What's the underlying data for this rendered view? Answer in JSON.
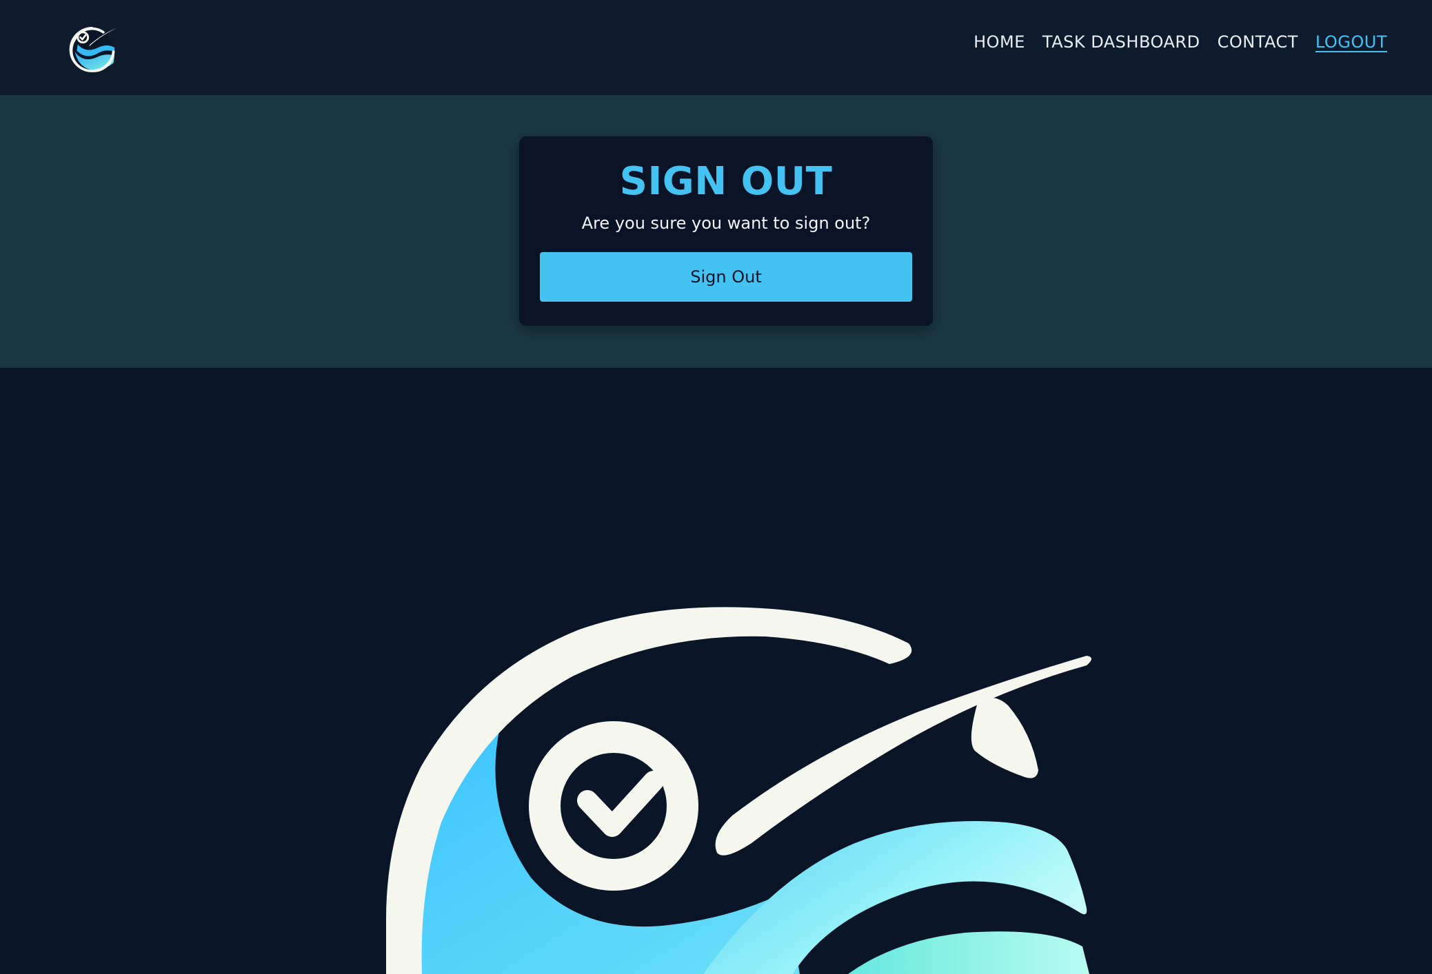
{
  "header": {
    "logo": "brand-logo-icon",
    "nav": [
      {
        "label": "HOME"
      },
      {
        "label": "TASK DASHBOARD"
      },
      {
        "label": "CONTACT"
      },
      {
        "label": "LOGOUT",
        "active": true
      }
    ]
  },
  "signout": {
    "title": "SIGN OUT",
    "message": "Are you sure you want to sign out?",
    "button_label": "Sign Out"
  },
  "hero": {
    "image": "brand-logo-icon"
  },
  "colors": {
    "accent": "#44c3f2",
    "nav_bg": "#0d1b2d",
    "band_bg": "#1b3744",
    "card_bg": "#0b1426",
    "page_bg": "#0a1628"
  }
}
